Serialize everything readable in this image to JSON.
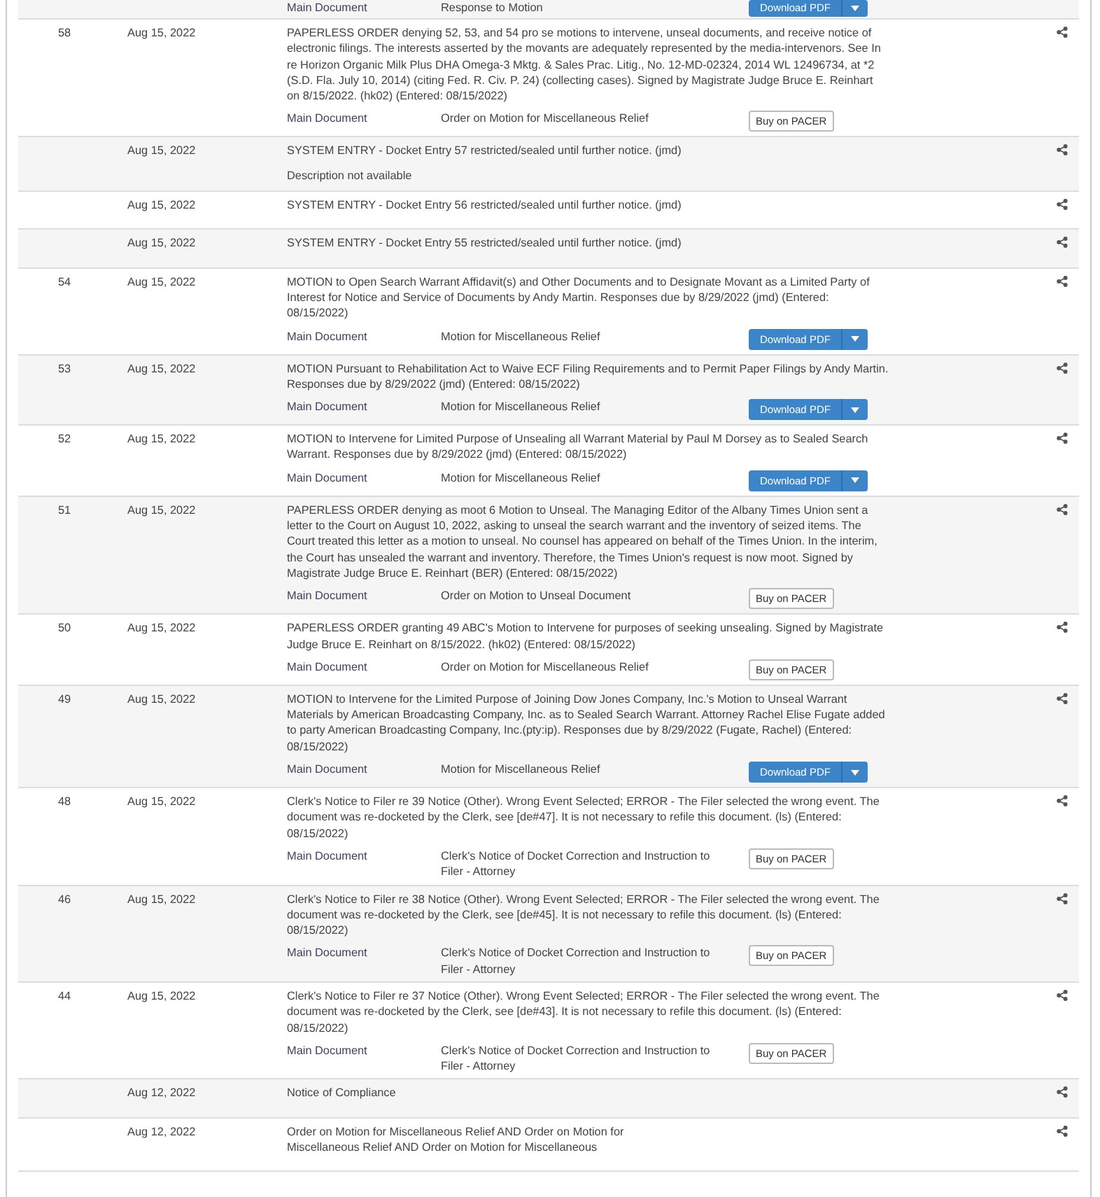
{
  "entries": [
    {
      "documents": [
        {
          "label": "Main Document",
          "type": "Response to Motion",
          "action": {
            "kind": "download",
            "label": "Download PDF"
          }
        }
      ]
    },
    {
      "number": "58",
      "date": "Aug 15, 2022",
      "description": "PAPERLESS ORDER denying 52, 53, and 54 pro se motions to intervene, unseal documents, and receive notice of electronic filings. The interests asserted by the movants are adequately represented by the media-intervenors. See In re Horizon Organic Milk Plus DHA Omega-3 Mktg. & Sales Prac. Litig., No. 12-MD-02324, 2014 WL 12496734, at *2 (S.D. Fla. July 10, 2014) (citing Fed. R. Civ. P. 24) (collecting cases). Signed by Magistrate Judge Bruce E. Reinhart on 8/15/2022. (hk02) (Entered: 08/15/2022)",
      "documents": [
        {
          "label": "Main Document",
          "type": "Order on Motion for Miscellaneous Relief",
          "action": {
            "kind": "buy",
            "label": "Buy on PACER"
          }
        }
      ]
    },
    {
      "date": "Aug 15, 2022",
      "description": "SYSTEM ENTRY - Docket Entry 57 restricted/sealed until further notice. (jmd)",
      "note": "Description not available"
    },
    {
      "date": "Aug 15, 2022",
      "description": "SYSTEM ENTRY - Docket Entry 56 restricted/sealed until further notice. (jmd)"
    },
    {
      "date": "Aug 15, 2022",
      "description": "SYSTEM ENTRY - Docket Entry 55 restricted/sealed until further notice. (jmd)"
    },
    {
      "number": "54",
      "date": "Aug 15, 2022",
      "description": "MOTION to Open Search Warrant Affidavit(s) and Other Documents and to Designate Movant as a Limited Party of Interest for Notice and Service of Documents by Andy Martin. Responses due by 8/29/2022 (jmd) (Entered: 08/15/2022)",
      "documents": [
        {
          "label": "Main Document",
          "type": "Motion for Miscellaneous Relief",
          "action": {
            "kind": "download",
            "label": "Download PDF"
          }
        }
      ]
    },
    {
      "number": "53",
      "date": "Aug 15, 2022",
      "description": "MOTION Pursuant to Rehabilitation Act to Waive ECF Filing Requirements and to Permit Paper Filings by Andy Martin. Responses due by 8/29/2022 (jmd) (Entered: 08/15/2022)",
      "documents": [
        {
          "label": "Main Document",
          "type": "Motion for Miscellaneous Relief",
          "action": {
            "kind": "download",
            "label": "Download PDF"
          }
        }
      ]
    },
    {
      "number": "52",
      "date": "Aug 15, 2022",
      "description": "MOTION to Intervene for Limited Purpose of Unsealing all Warrant Material by Paul M Dorsey as to Sealed Search Warrant. Responses due by 8/29/2022 (jmd) (Entered: 08/15/2022)",
      "documents": [
        {
          "label": "Main Document",
          "type": "Motion for Miscellaneous Relief",
          "action": {
            "kind": "download",
            "label": "Download PDF"
          }
        }
      ]
    },
    {
      "number": "51",
      "date": "Aug 15, 2022",
      "description": "PAPERLESS ORDER denying as moot 6 Motion to Unseal. The Managing Editor of the Albany Times Union sent a letter to the Court on August 10, 2022, asking to unseal the search warrant and the inventory of seized items. The Court treated this letter as a motion to unseal. No counsel has appeared on behalf of the Times Union. In the interim, the Court has unsealed the warrant and inventory. Therefore, the Times Union's request is now moot. Signed by Magistrate Judge Bruce E. Reinhart (BER) (Entered: 08/15/2022)",
      "documents": [
        {
          "label": "Main Document",
          "type": "Order on Motion to Unseal Document",
          "action": {
            "kind": "buy",
            "label": "Buy on PACER"
          }
        }
      ]
    },
    {
      "number": "50",
      "date": "Aug 15, 2022",
      "description": "PAPERLESS ORDER granting 49 ABC's Motion to Intervene for purposes of seeking unsealing. Signed by Magistrate Judge Bruce E. Reinhart on 8/15/2022. (hk02) (Entered: 08/15/2022)",
      "documents": [
        {
          "label": "Main Document",
          "type": "Order on Motion for Miscellaneous Relief",
          "action": {
            "kind": "buy",
            "label": "Buy on PACER"
          }
        }
      ]
    },
    {
      "number": "49",
      "date": "Aug 15, 2022",
      "description": "MOTION to Intervene for the Limited Purpose of Joining Dow Jones Company, Inc.'s Motion to Unseal Warrant Materials by American Broadcasting Company, Inc. as to Sealed Search Warrant. Attorney Rachel Elise Fugate added to party American Broadcasting Company, Inc.(pty:ip). Responses due by 8/29/2022 (Fugate, Rachel) (Entered: 08/15/2022)",
      "documents": [
        {
          "label": "Main Document",
          "type": "Motion for Miscellaneous Relief",
          "action": {
            "kind": "download",
            "label": "Download PDF"
          }
        }
      ]
    },
    {
      "number": "48",
      "date": "Aug 15, 2022",
      "description": "Clerk's Notice to Filer re 39 Notice (Other). Wrong Event Selected; ERROR - The Filer selected the wrong event. The document was re-docketed by the Clerk, see [de#47]. It is not necessary to refile this document. (ls) (Entered: 08/15/2022)",
      "documents": [
        {
          "label": "Main Document",
          "type": "Clerk's Notice of Docket Correction and Instruction to Filer - Attorney",
          "action": {
            "kind": "buy",
            "label": "Buy on PACER"
          }
        }
      ]
    },
    {
      "number": "46",
      "date": "Aug 15, 2022",
      "description": "Clerk's Notice to Filer re 38 Notice (Other). Wrong Event Selected; ERROR - The Filer selected the wrong event. The document was re-docketed by the Clerk, see [de#45]. It is not necessary to refile this document. (ls) (Entered: 08/15/2022)",
      "documents": [
        {
          "label": "Main Document",
          "type": "Clerk's Notice of Docket Correction and Instruction to Filer - Attorney",
          "action": {
            "kind": "buy",
            "label": "Buy on PACER"
          }
        }
      ]
    },
    {
      "number": "44",
      "date": "Aug 15, 2022",
      "description": "Clerk's Notice to Filer re 37 Notice (Other). Wrong Event Selected; ERROR - The Filer selected the wrong event. The document was re-docketed by the Clerk, see [de#43]. It is not necessary to refile this document. (ls) (Entered: 08/15/2022)",
      "documents": [
        {
          "label": "Main Document",
          "type": "Clerk's Notice of Docket Correction and Instruction to Filer - Attorney",
          "action": {
            "kind": "buy",
            "label": "Buy on PACER"
          }
        }
      ]
    },
    {
      "date": "Aug 12, 2022",
      "description": "Notice of Compliance"
    },
    {
      "date": "Aug 12, 2022",
      "description": "Order on Motion for Miscellaneous Relief AND Order on Motion for Miscellaneous Relief AND Order on Motion for Miscellaneous"
    }
  ]
}
